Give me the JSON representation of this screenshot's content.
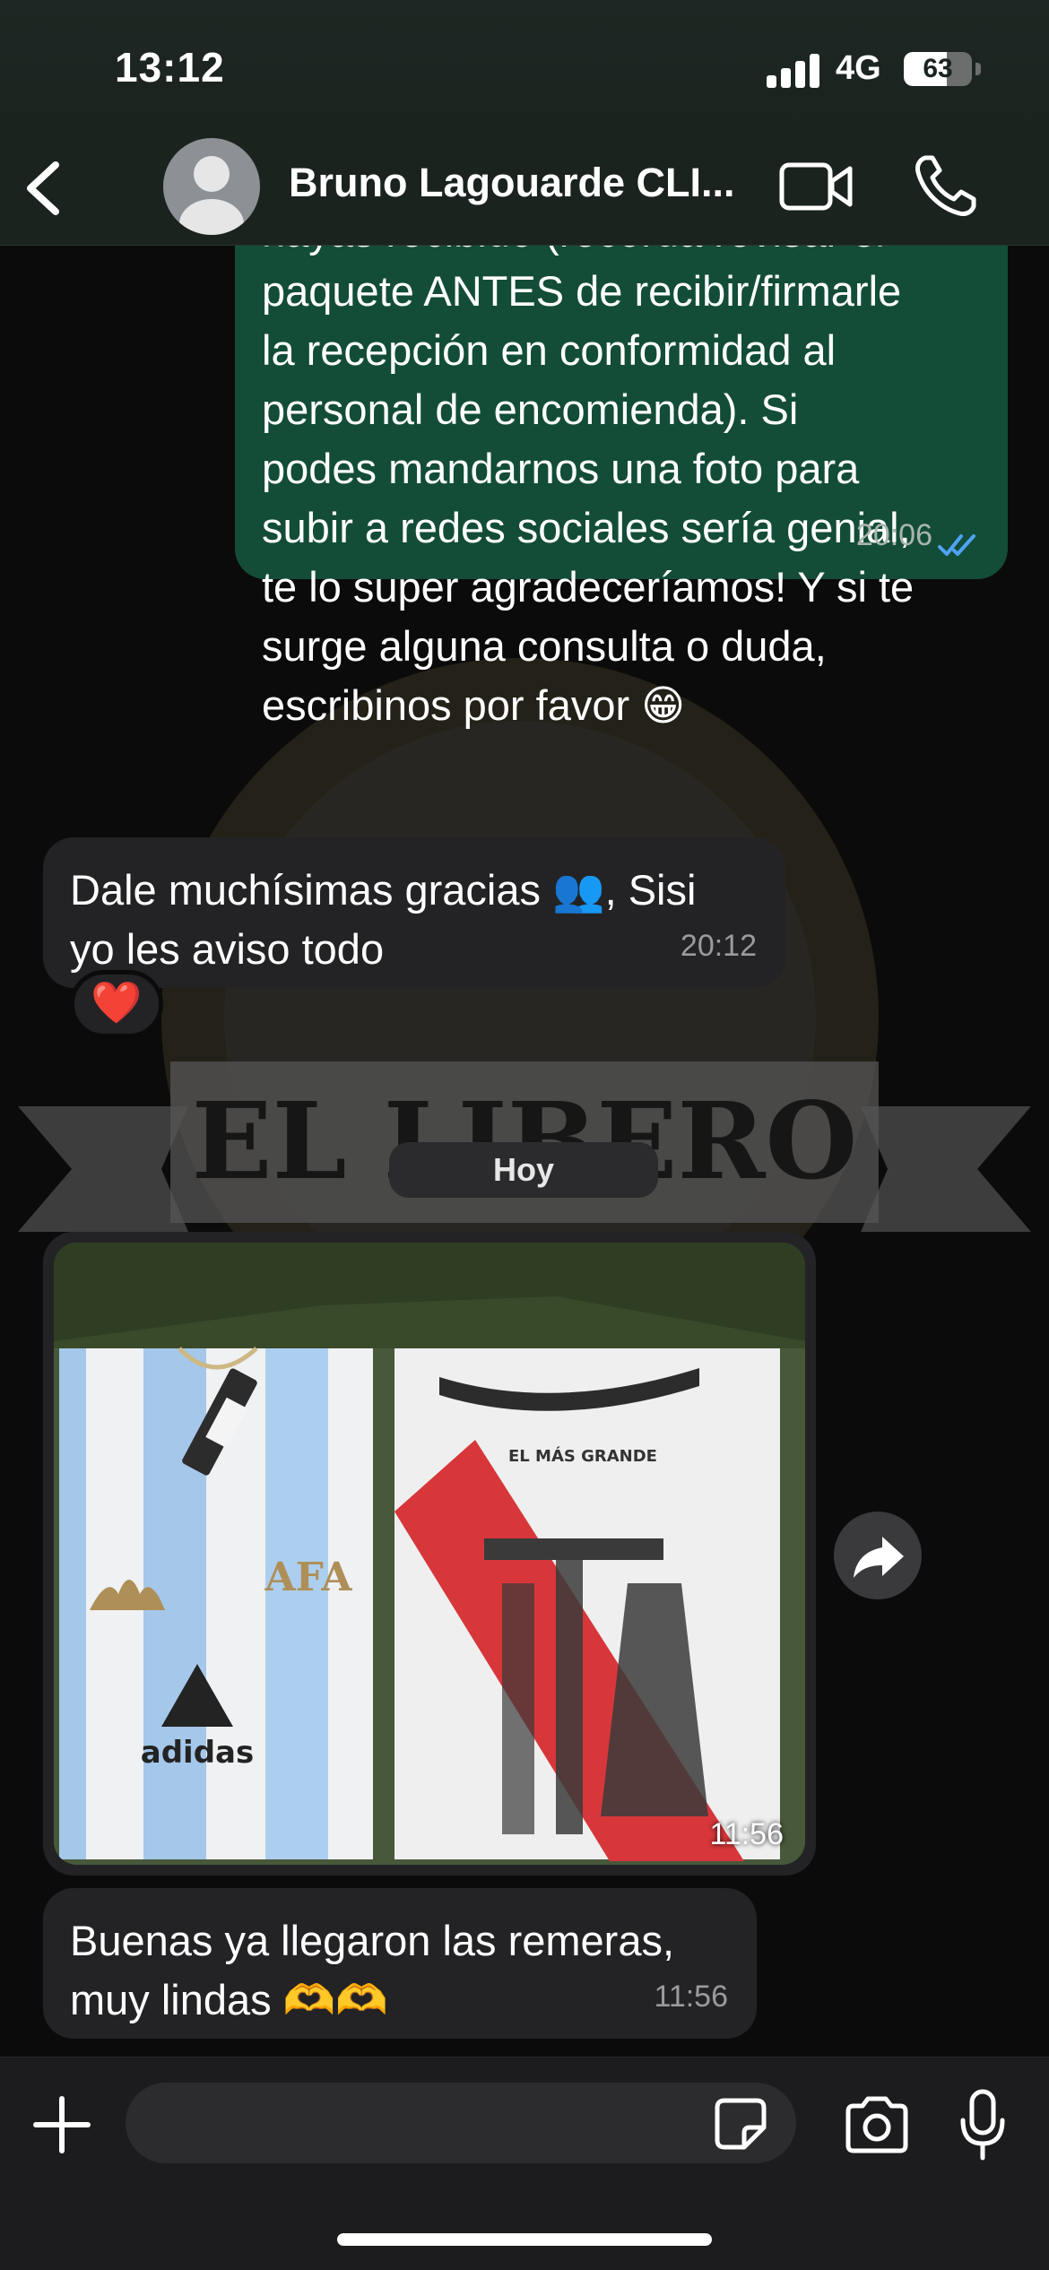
{
  "status_bar": {
    "time": "13:12",
    "network": "4G",
    "battery_percent": 63,
    "battery_label": "63"
  },
  "header": {
    "contact_name": "Bruno Lagouarde CLI...",
    "icons": [
      "back-chevron-icon",
      "default-avatar-icon",
      "video-call-icon",
      "phone-icon"
    ]
  },
  "chat": {
    "messages": [
      {
        "direction": "outgoing",
        "text": "hayas recibido (recorda revisar el\npaquete ANTES de recibir/firmarle\nla recepción en conformidad al\npersonal de encomienda). Si\npodes mandarnos una foto para\nsubir a redes sociales sería genial,\nte lo super agradeceríamos! Y si te\nsurge alguna consulta o duda,\nescribinos por favor 😁",
        "time": "20:06",
        "status": "read"
      },
      {
        "direction": "incoming",
        "text": "Dale muchísimas gracias 👥, Sisi\nyo les aviso todo",
        "time": "20:12",
        "reaction": "❤️"
      },
      {
        "direction": "incoming",
        "type": "photo",
        "time": "11:56",
        "photo_labels": {
          "left_shirt_badge": "AFA",
          "left_shirt_brand": "adidas",
          "right_shirt_text": "EL MÁS GRANDE"
        }
      },
      {
        "direction": "incoming",
        "text": "Buenas ya llegaron las remeras,\nmuy lindas 🫶🫶",
        "time": "11:56"
      }
    ],
    "day_separator": "Hoy",
    "wallpaper_text": "EL LIBERO"
  },
  "composer": {
    "placeholder": "",
    "icons": [
      "plus-icon",
      "sticker-icon",
      "camera-icon",
      "microphone-icon"
    ]
  },
  "colors": {
    "outgoing_bubble": "#134d37",
    "incoming_bubble": "#232325",
    "read_ticks": "#4fa3f7",
    "header_bg": "#1b231f"
  }
}
